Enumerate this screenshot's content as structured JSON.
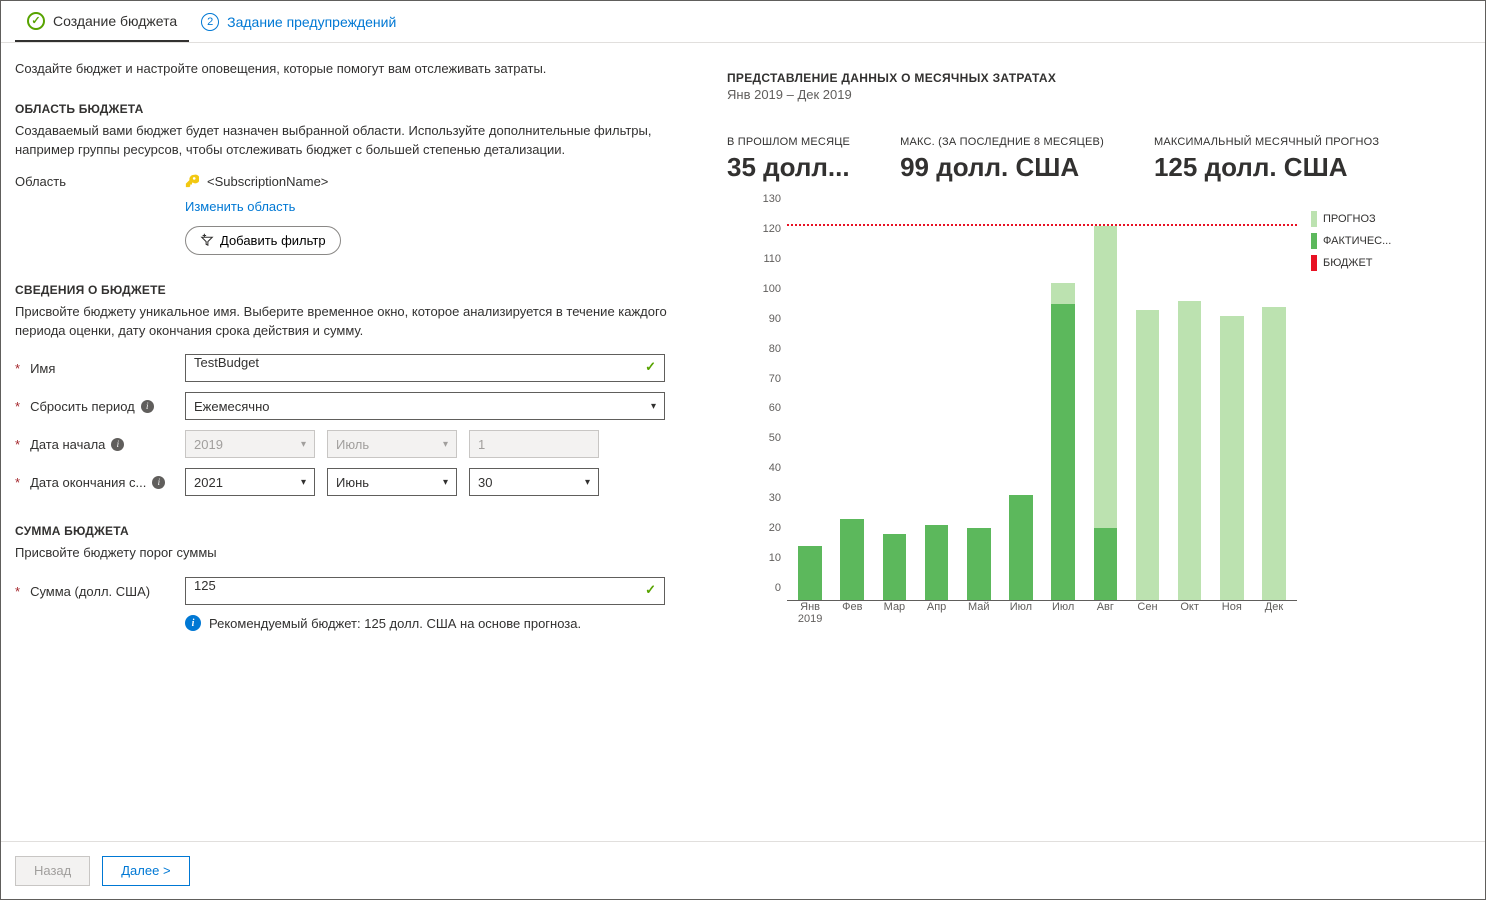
{
  "tabs": {
    "step1_label": "Создание бюджета",
    "step2_label": "Задание предупреждений",
    "step2_number": "2"
  },
  "intro": "Создайте бюджет и настройте оповещения, которые помогут вам отслеживать затраты.",
  "scope": {
    "title": "ОБЛАСТЬ БЮДЖЕТА",
    "desc": "Создаваемый вами бюджет будет назначен выбранной области. Используйте дополнительные фильтры, например группы ресурсов, чтобы отслеживать бюджет с большей степенью детализации.",
    "label": "Область",
    "value": "<SubscriptionName>",
    "change_link": "Изменить область",
    "add_filter": "Добавить фильтр"
  },
  "details": {
    "title": "СВЕДЕНИЯ О БЮДЖЕТЕ",
    "desc": "Присвойте бюджету уникальное имя. Выберите временное окно, которое анализируется в течение каждого периода оценки, дату окончания срока действия и сумму.",
    "name_label": "Имя",
    "name_value": "TestBudget",
    "reset_label": "Сбросить период",
    "reset_value": "Ежемесячно",
    "start_label": "Дата начала",
    "start_year": "2019",
    "start_month": "Июль",
    "start_day": "1",
    "end_label": "Дата окончания с...",
    "end_year": "2021",
    "end_month": "Июнь",
    "end_day": "30"
  },
  "amount": {
    "title": "СУММА БЮДЖЕТА",
    "desc": "Присвойте бюджету порог суммы",
    "label": "Сумма (долл. США)",
    "value": "125",
    "hint": "Рекомендуемый бюджет: 125 долл. США на основе прогноза."
  },
  "right": {
    "title": "ПРЕДСТАВЛЕНИЕ ДАННЫХ О МЕСЯЧНЫХ ЗАТРАТАХ",
    "subtitle": "Янв 2019 – Дек 2019",
    "stat1_label": "В ПРОШЛОМ МЕСЯЦЕ",
    "stat1_value": "35 долл...",
    "stat2_label": "МАКС. (ЗА ПОСЛЕДНИЕ 8 МЕСЯЦЕВ)",
    "stat2_value": "99 долл. США",
    "stat3_label": "МАКСИМАЛЬНЫЙ МЕСЯЧНЫЙ ПРОГНОЗ",
    "stat3_value": "125 долл. США",
    "legend_forecast": "ПРОГНОЗ",
    "legend_actual": "ФАКТИЧЕС...",
    "legend_budget": "БЮДЖЕТ"
  },
  "footer": {
    "back": "Назад",
    "next": "Далее  >"
  },
  "chart_data": {
    "type": "bar",
    "ylim": [
      0,
      130
    ],
    "yticks": [
      0,
      10,
      20,
      30,
      40,
      50,
      60,
      70,
      80,
      90,
      100,
      110,
      120,
      130
    ],
    "budget_line": 125,
    "categories": [
      "Янв 2019",
      "Фев",
      "Мар",
      "Апр",
      "Май",
      "Июл",
      "Июл",
      "Авг",
      "Сен",
      "Окт",
      "Ноя",
      "Дек"
    ],
    "series": [
      {
        "name": "ПРОГНОЗ",
        "values": [
          null,
          null,
          null,
          null,
          null,
          null,
          106,
          125,
          97,
          100,
          95,
          98
        ]
      },
      {
        "name": "ФАКТИЧЕС...",
        "values": [
          18,
          27,
          22,
          25,
          24,
          35,
          99,
          24,
          null,
          null,
          null,
          null
        ]
      }
    ]
  }
}
